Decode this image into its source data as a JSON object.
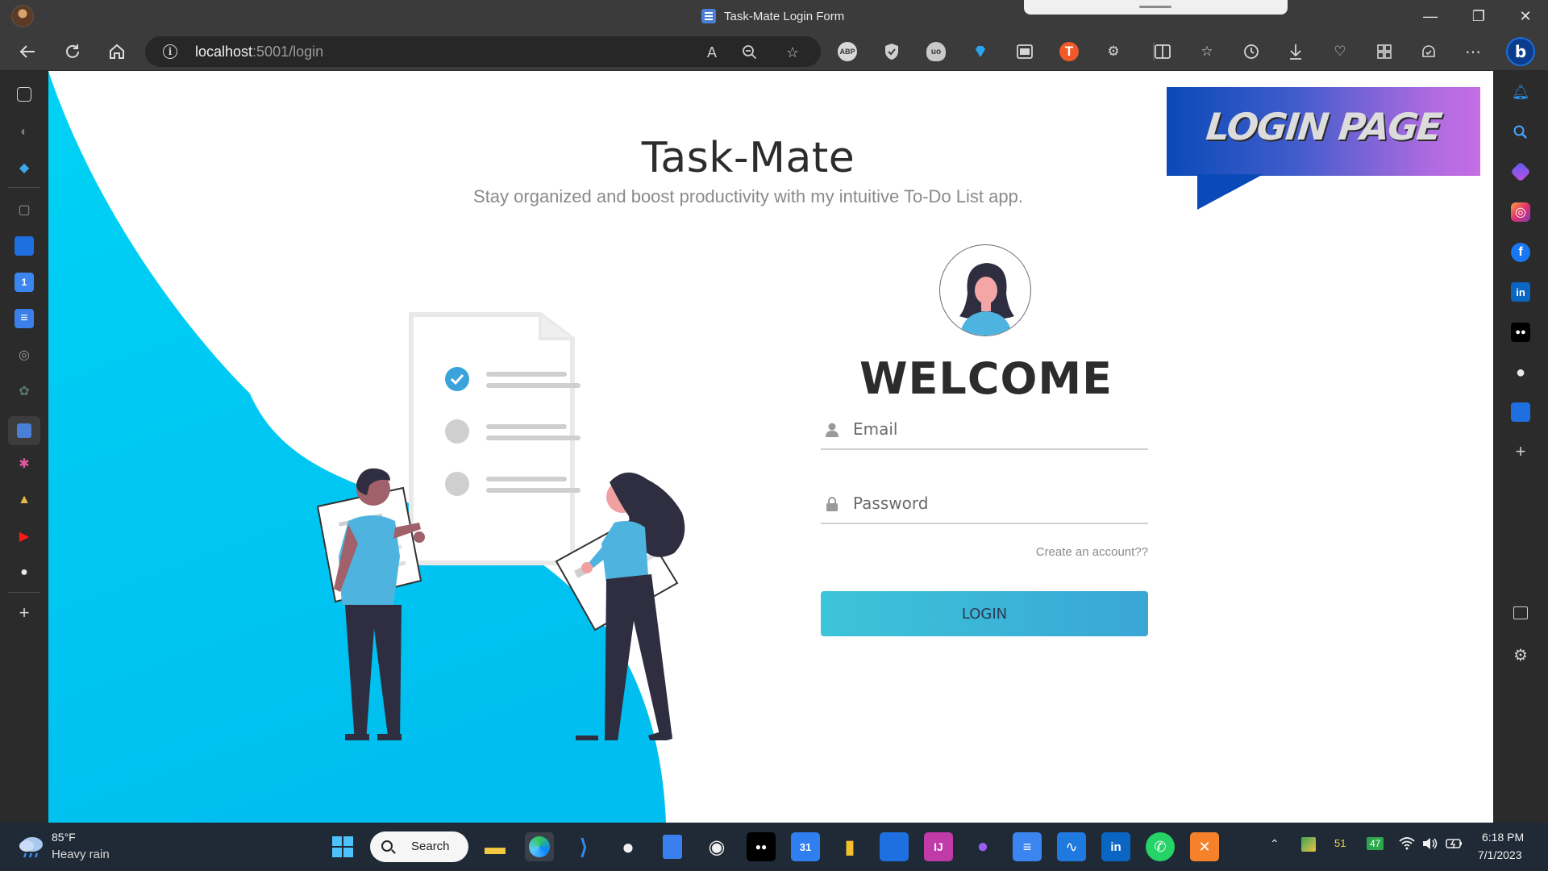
{
  "window": {
    "tab_title": "Task-Mate Login Form",
    "minimize": "—",
    "restore": "❐",
    "close": "✕"
  },
  "address_bar": {
    "url_host": "localhost",
    "url_rest": ":5001/login"
  },
  "page": {
    "app_title": "Task-Mate",
    "app_subtitle": "Stay organized and boost productivity with my intuitive To-Do List app.",
    "banner_text": "LOGIN PAGE",
    "welcome": "WELCOME",
    "email_placeholder": "Email",
    "password_placeholder": "Password",
    "create_account": "Create an account??",
    "login_button": "LOGIN"
  },
  "colors": {
    "wave_blue": "#00c8f0",
    "login_button_start": "#3cc4d8",
    "login_button_end": "#3aa6d6",
    "banner_start": "#0a4ab8",
    "banner_end": "#c56de5"
  },
  "taskbar": {
    "weather_temp": "85°F",
    "weather_desc": "Heavy rain",
    "search_label": "Search",
    "tray_badge_1": "51",
    "tray_badge_2": "47",
    "clock_time": "6:18 PM",
    "clock_date": "7/1/2023"
  }
}
